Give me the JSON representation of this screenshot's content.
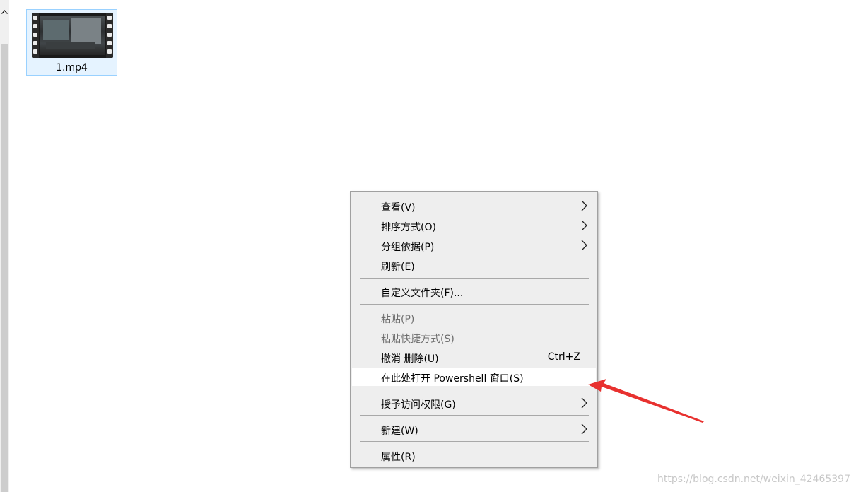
{
  "file": {
    "name": "1.mp4",
    "icon": "video-file-icon"
  },
  "context_menu": {
    "items": [
      {
        "label": "查看(V)",
        "submenu": true,
        "disabled": false
      },
      {
        "label": "排序方式(O)",
        "submenu": true,
        "disabled": false
      },
      {
        "label": "分组依据(P)",
        "submenu": true,
        "disabled": false
      },
      {
        "label": "刷新(E)",
        "submenu": false,
        "disabled": false
      },
      {
        "label": "自定义文件夹(F)...",
        "submenu": false,
        "disabled": false
      },
      {
        "label": "粘贴(P)",
        "submenu": false,
        "disabled": true
      },
      {
        "label": "粘贴快捷方式(S)",
        "submenu": false,
        "disabled": true
      },
      {
        "label": "撤消 删除(U)",
        "shortcut": "Ctrl+Z",
        "submenu": false,
        "disabled": false
      },
      {
        "label": "在此处打开 Powershell 窗口(S)",
        "submenu": false,
        "disabled": false,
        "highlighted": true
      },
      {
        "label": "授予访问权限(G)",
        "submenu": true,
        "disabled": false
      },
      {
        "label": "新建(W)",
        "submenu": true,
        "disabled": false
      },
      {
        "label": "属性(R)",
        "submenu": false,
        "disabled": false
      }
    ]
  },
  "watermark": "https://blog.csdn.net/weixin_42465397",
  "colors": {
    "menu_bg": "#eeeeee",
    "highlight_bg": "#ffffff",
    "selection_border": "#99d1ff",
    "arrow": "#e8312f"
  }
}
